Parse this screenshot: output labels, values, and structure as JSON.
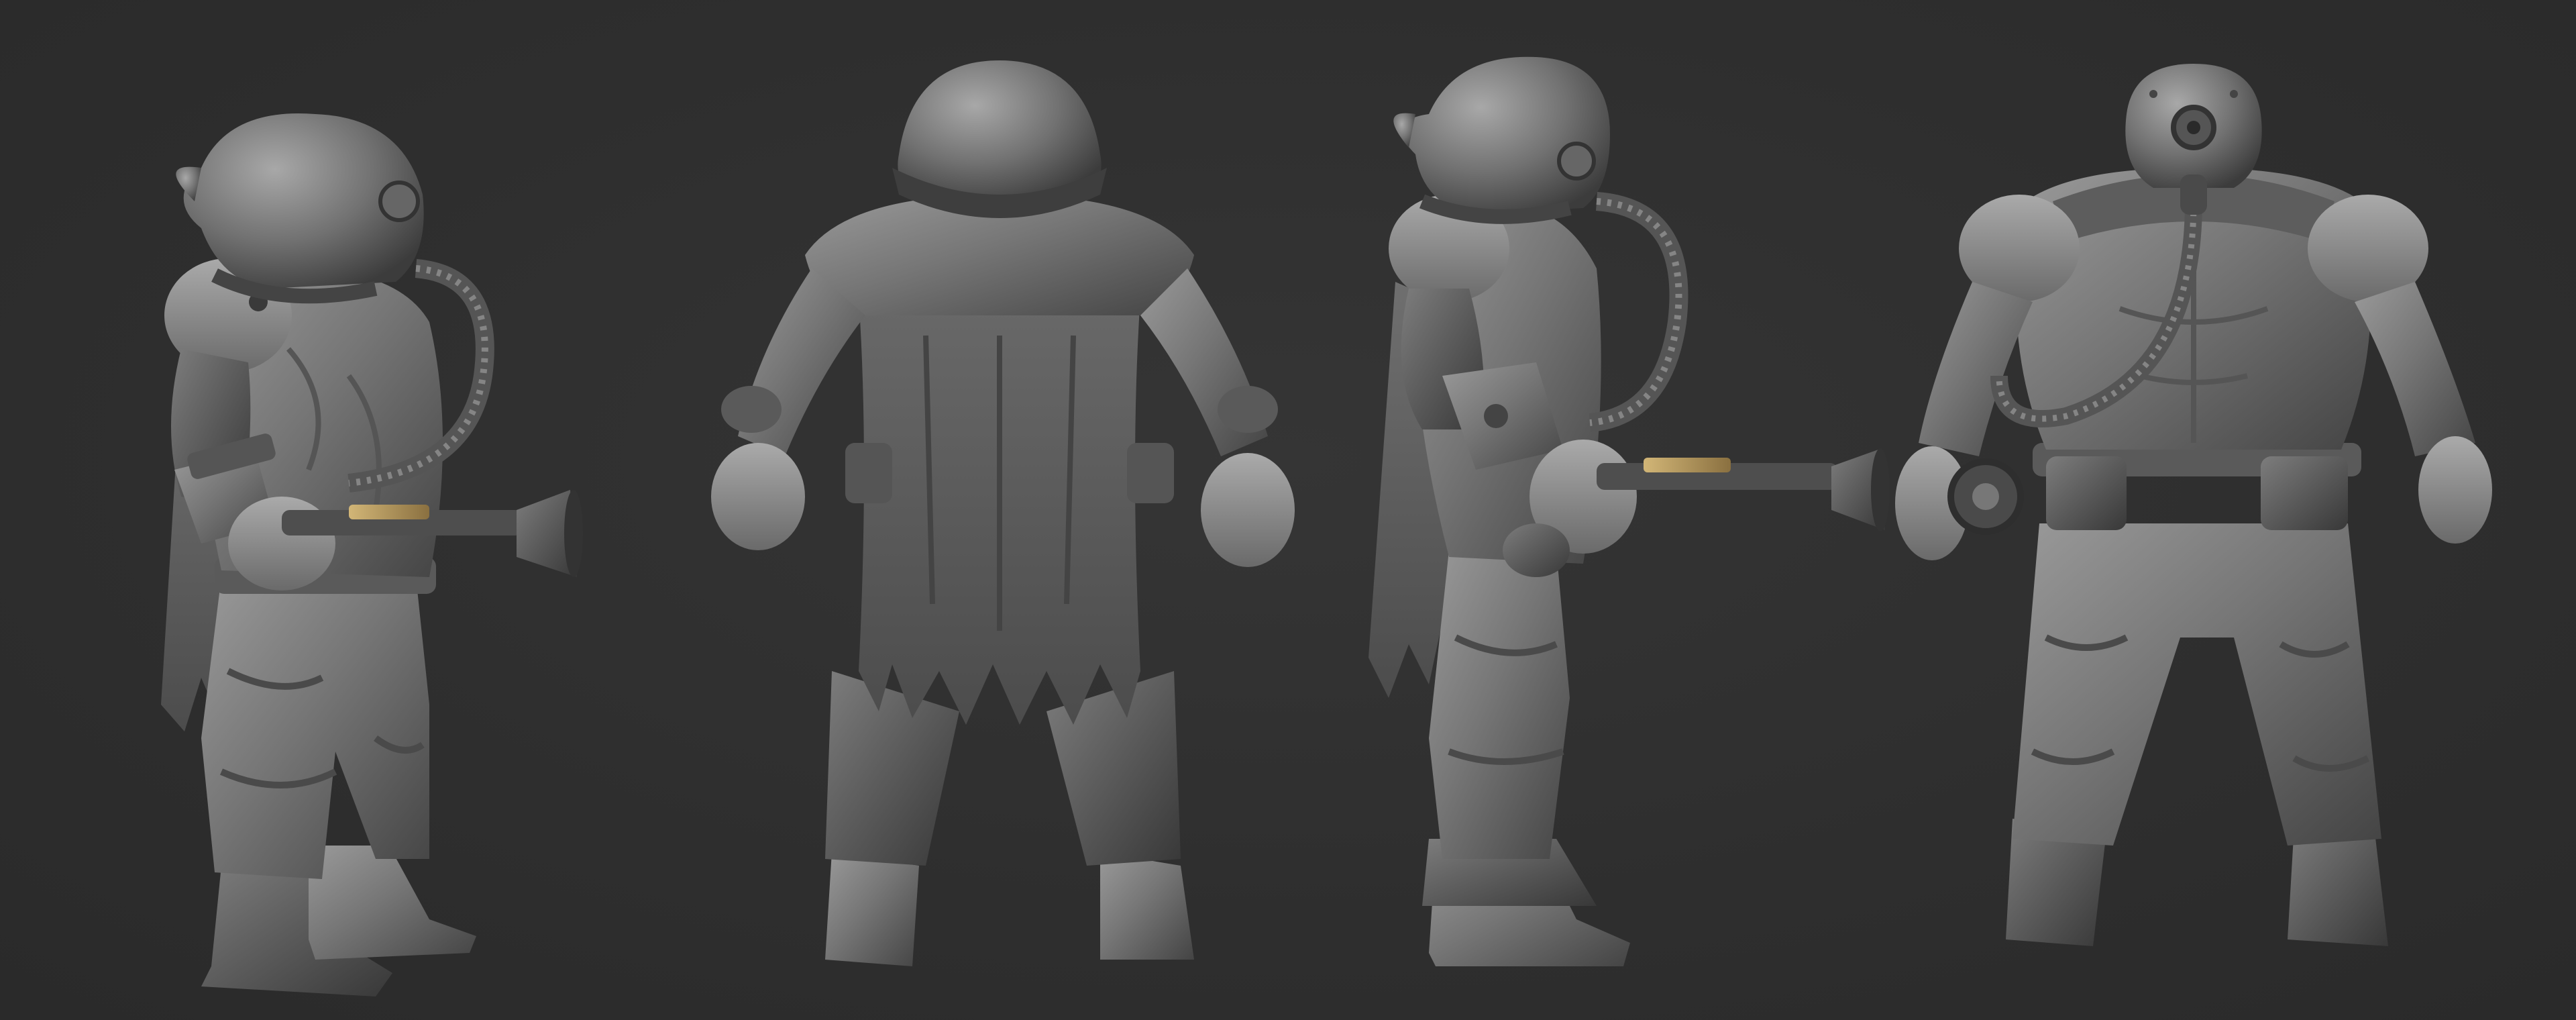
{
  "scene": {
    "background_color": "#2f2f2f",
    "material_color": "#7a7a7a",
    "metal_accent_color": "#b89a5a",
    "views": [
      {
        "name": "side-view-left",
        "facing": "right",
        "holds_weapon": true
      },
      {
        "name": "back-view",
        "facing": "away",
        "holds_weapon": false
      },
      {
        "name": "side-view-right",
        "facing": "right",
        "holds_weapon": true
      },
      {
        "name": "front-view",
        "facing": "viewer",
        "holds_weapon": false
      }
    ]
  }
}
